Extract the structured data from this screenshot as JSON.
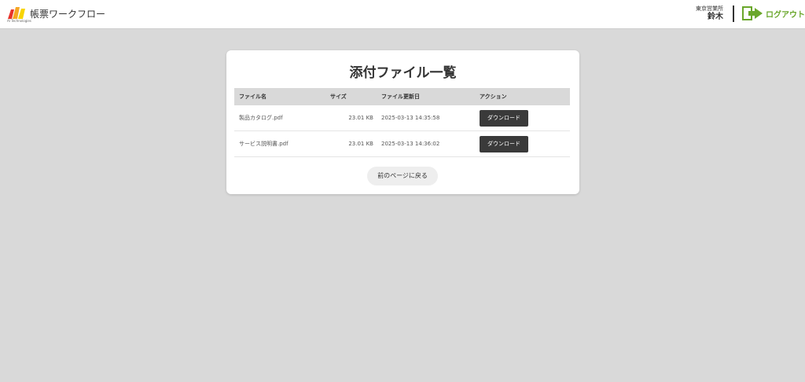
{
  "header": {
    "logo_sub": "AI Technologies",
    "app_title": "帳票ワークフロー",
    "user_dept": "東京営業所",
    "user_name": "鈴木",
    "logout_label": "ログアウト",
    "logout_icon": "logout-arrow-icon",
    "accent_color": "#6aa72b"
  },
  "card": {
    "title": "添付ファイル一覧",
    "columns": [
      "ファイル名",
      "サイズ",
      "ファイル更新日",
      "アクション"
    ],
    "rows": [
      {
        "name": "製品カタログ.pdf",
        "size": "23.01 KB",
        "date": "2025-03-13 14:35:58",
        "action": "ダウンロード"
      },
      {
        "name": "サービス説明書.pdf",
        "size": "23.01 KB",
        "date": "2025-03-13 14:36:02",
        "action": "ダウンロード"
      }
    ],
    "back_label": "前のページに戻る"
  }
}
